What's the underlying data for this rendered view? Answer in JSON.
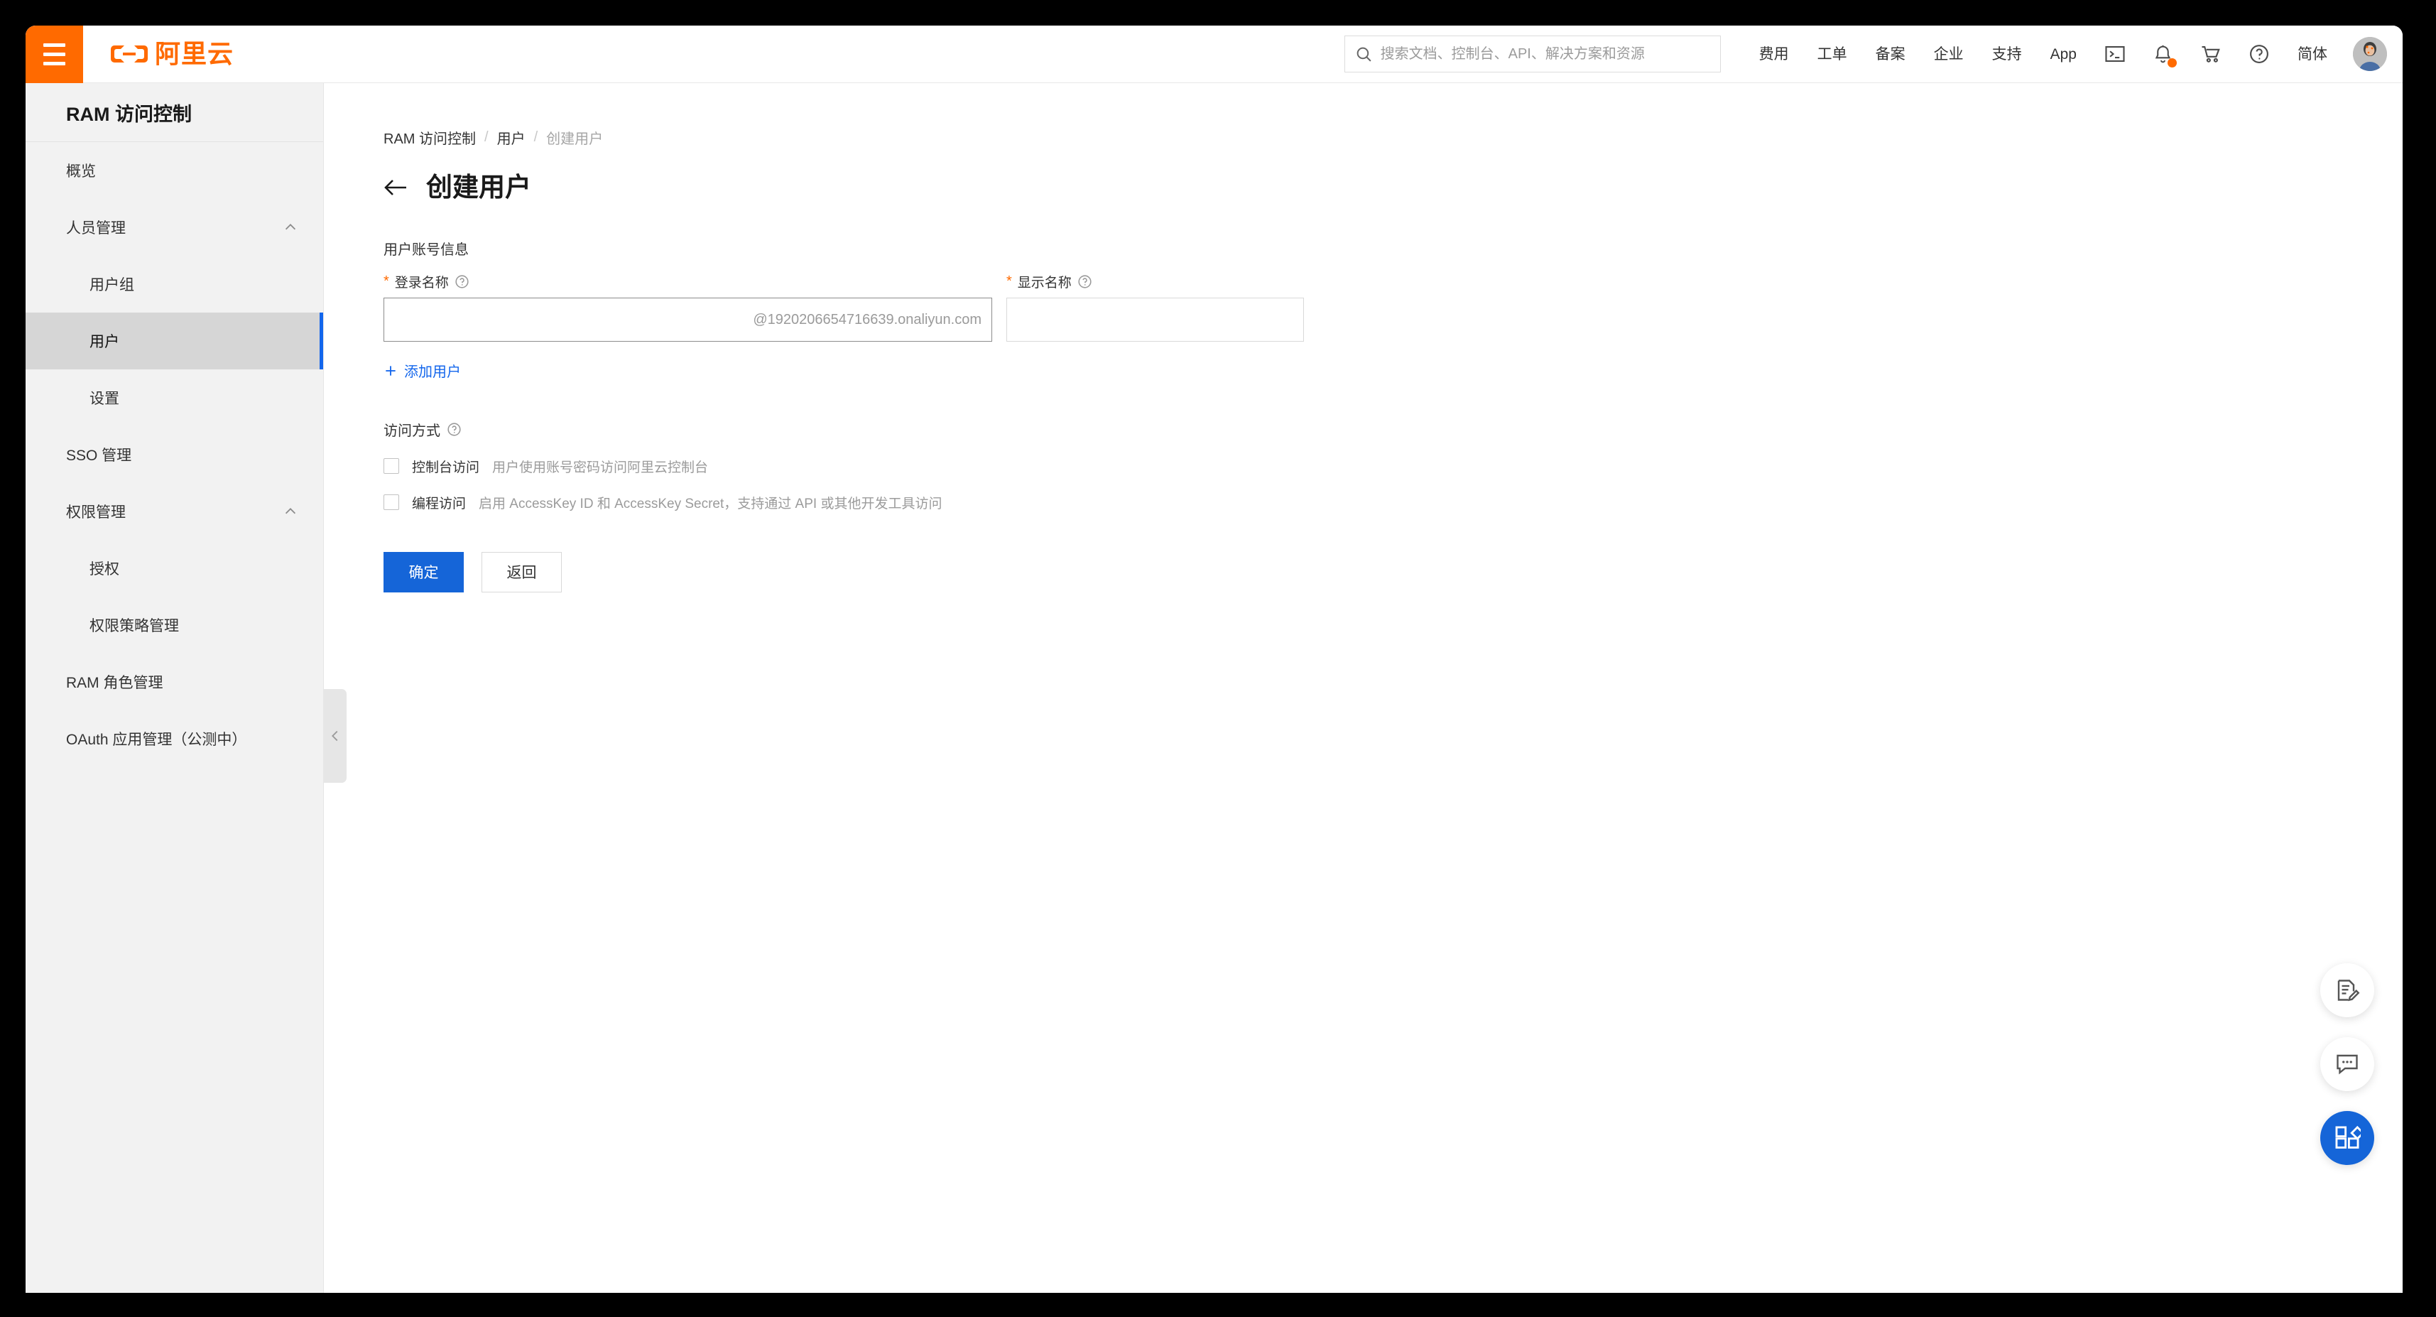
{
  "header": {
    "hamburger_icon": "hamburger-menu-icon",
    "logo_text": "阿里云",
    "search": {
      "icon": "search-icon",
      "placeholder": "搜索文档、控制台、API、解决方案和资源",
      "value": ""
    },
    "nav_items": [
      {
        "label": "费用"
      },
      {
        "label": "工单"
      },
      {
        "label": "备案"
      },
      {
        "label": "企业"
      },
      {
        "label": "支持"
      },
      {
        "label": "App"
      }
    ],
    "icons": [
      {
        "name": "terminal-icon",
        "has_badge": false
      },
      {
        "name": "bell-icon",
        "has_badge": true
      },
      {
        "name": "cart-icon",
        "has_badge": false
      },
      {
        "name": "help-icon",
        "has_badge": false
      }
    ],
    "language_label": "简体",
    "avatar_name": "user-avatar",
    "badge_color": "#ff6a00",
    "brand_color": "#ff6a00"
  },
  "sidebar": {
    "title": "RAM 访问控制",
    "collapse_icon": "chevron-left-icon",
    "items": [
      {
        "label": "概览",
        "level": 0,
        "active": false,
        "expandable": false
      },
      {
        "label": "人员管理",
        "level": 0,
        "active": false,
        "expandable": true,
        "expanded": true
      },
      {
        "label": "用户组",
        "level": 1,
        "active": false,
        "expandable": false
      },
      {
        "label": "用户",
        "level": 1,
        "active": true,
        "expandable": false
      },
      {
        "label": "设置",
        "level": 1,
        "active": false,
        "expandable": false
      },
      {
        "label": "SSO 管理",
        "level": 0,
        "active": false,
        "expandable": false
      },
      {
        "label": "权限管理",
        "level": 0,
        "active": false,
        "expandable": true,
        "expanded": true
      },
      {
        "label": "授权",
        "level": 1,
        "active": false,
        "expandable": false
      },
      {
        "label": "权限策略管理",
        "level": 1,
        "active": false,
        "expandable": false
      },
      {
        "label": "RAM 角色管理",
        "level": 0,
        "active": false,
        "expandable": false
      },
      {
        "label": "OAuth 应用管理（公测中）",
        "level": 0,
        "active": false,
        "expandable": false
      }
    ],
    "active_indicator_color": "#1366ec"
  },
  "breadcrumb": {
    "items": [
      {
        "label": "RAM 访问控制",
        "current": false
      },
      {
        "label": "用户",
        "current": false
      },
      {
        "label": "创建用户",
        "current": true
      }
    ],
    "separator": "/"
  },
  "main": {
    "back_icon": "arrow-left-icon",
    "page_title": "创建用户",
    "account_section": {
      "label": "用户账号信息",
      "login_name": {
        "label": "登录名称",
        "required_mark": "*",
        "help_icon": "question-circle-icon",
        "value": "",
        "placeholder": "@1920206654716639.onaliyun.com",
        "focused": true
      },
      "display_name": {
        "label": "显示名称",
        "required_mark": "*",
        "help_icon": "question-circle-icon",
        "value": "",
        "placeholder": "",
        "focused": false
      },
      "add_user_link": "添加用户",
      "add_user_icon": "plus-icon"
    },
    "access_section": {
      "label": "访问方式",
      "help_icon": "question-circle-icon",
      "options": [
        {
          "label": "控制台访问",
          "description": "用户使用账号密码访问阿里云控制台",
          "checked": false
        },
        {
          "label": "编程访问",
          "description": "启用 AccessKey ID 和 AccessKey Secret，支持通过 API 或其他开发工具访问",
          "checked": false
        }
      ]
    },
    "buttons": {
      "confirm_label": "确定",
      "back_label": "返回",
      "primary_color": "#1565d8"
    }
  },
  "floating_buttons": [
    {
      "name": "feedback-survey-icon",
      "style": "white"
    },
    {
      "name": "chat-support-icon",
      "style": "white"
    },
    {
      "name": "apps-grid-icon",
      "style": "blue"
    }
  ]
}
